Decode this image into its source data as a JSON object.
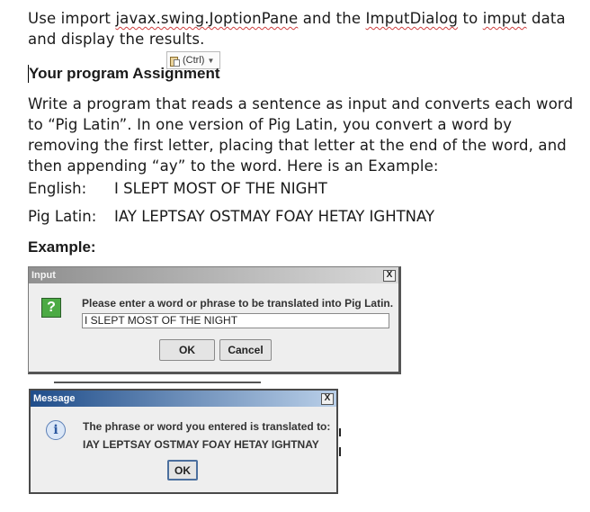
{
  "intro": {
    "before": "Use import ",
    "link1": "javax.swing.JoptionPane",
    "middle": " and the ",
    "link2": "ImputDialog",
    "to": " to ",
    "link3": "imput",
    "after": " data and display the results."
  },
  "paste_options": {
    "label": "(Ctrl)",
    "icon": "clipboard-icon"
  },
  "assignment_heading": "Your program Assignment",
  "description": "Write a program that reads a sentence as input and converts each word to “Pig Latin”. In one version of Pig Latin, you convert a word by removing the first letter, placing that letter at the end of the word, and then appending “ay” to the word. Here is an Example:",
  "english": {
    "label": "English:",
    "value": "I SLEPT MOST OF THE NIGHT"
  },
  "piglatin": {
    "label": "Pig Latin:",
    "value": "IAY LEPTSAY OSTMAY FOAY HETAY IGHTNAY"
  },
  "example_heading": "Example:",
  "input_dialog": {
    "title": "Input",
    "close": "X",
    "icon": "question-icon",
    "icon_glyph": "?",
    "prompt": "Please enter a word or phrase to be translated into Pig Latin.",
    "value": "I SLEPT MOST OF THE NIGHT",
    "ok": "OK",
    "cancel": "Cancel"
  },
  "message_dialog": {
    "title": "Message",
    "close": "X",
    "icon": "info-icon",
    "icon_glyph": "i",
    "line1": "The phrase or word you entered is translated to:",
    "line2": "IAY LEPTSAY OSTMAY FOAY HETAY IGHTNAY",
    "ok": "OK"
  },
  "colors": {
    "message_title_start": "#1f4d8a",
    "input_title_start": "#909090",
    "question_icon": "#4caa44",
    "spell_squiggle": "#d04040"
  }
}
